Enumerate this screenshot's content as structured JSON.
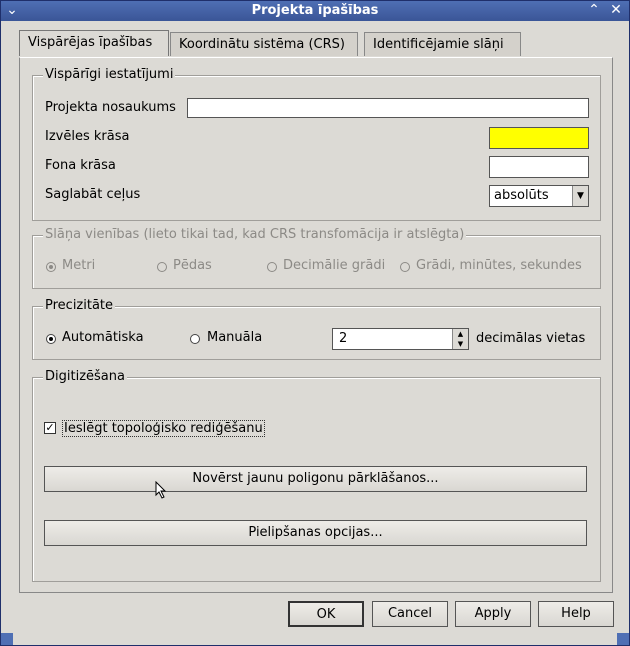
{
  "window": {
    "title": "Projekta īpašības"
  },
  "tabs": [
    "Vispārējas īpašības",
    "Koordinātu sistēma (CRS)",
    "Identificējamie slāņi"
  ],
  "general": {
    "legend": "Vispārīgi iestatījumi",
    "project_name_label": "Projekta nosaukums",
    "project_name_value": "",
    "selection_color_label": "Izvēles krāsa",
    "selection_color": "#ffff00",
    "background_color_label": "Fona krāsa",
    "background_color": "#ffffff",
    "save_paths_label": "Saglabāt ceļus",
    "save_paths_value": "absolūts"
  },
  "units": {
    "legend": "Slāņa vienības (lieto tikai tad, kad CRS transfomācija ir atslēgta)",
    "options": [
      "Metri",
      "Pēdas",
      "Decimālie grādi",
      "Grādi, minūtes, sekundes"
    ]
  },
  "precision": {
    "legend": "Precizitāte",
    "auto_label": "Automātiska",
    "manual_label": "Manuāla",
    "value": "2",
    "suffix": "decimālas vietas"
  },
  "digitizing": {
    "legend": "Digitizēšana",
    "topology_label": "Ieslēgt topoloģisko rediģēšanu",
    "topology_checked": true,
    "avoid_overlaps_button": "Novērst jaunu poligonu pārklāšanos...",
    "snapping_button": "Pielipšanas opcijas..."
  },
  "footer": {
    "ok": "OK",
    "cancel": "Cancel",
    "apply": "Apply",
    "help": "Help"
  }
}
